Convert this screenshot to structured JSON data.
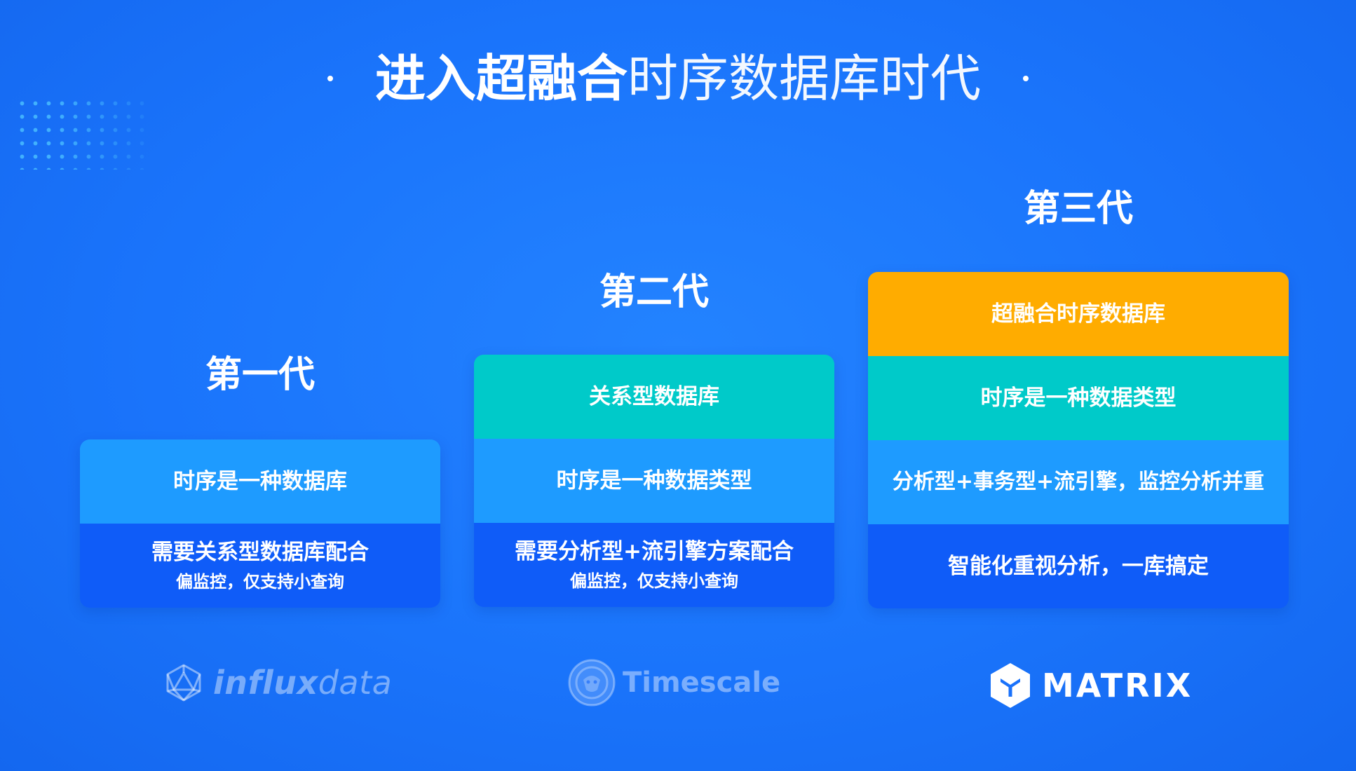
{
  "title": {
    "bold": "进入超融合",
    "light": "时序数据库时代"
  },
  "generations": [
    {
      "label": "第一代",
      "rows": [
        {
          "text": "时序是一种数据库",
          "color": "#1e9bff"
        },
        {
          "text": "需要关系型数据库配合",
          "sub": "偏监控，仅支持小查询",
          "color": "#0f5cf8"
        }
      ],
      "logo": {
        "icon": "icosahedron-icon",
        "bold": "influx",
        "light": "data"
      }
    },
    {
      "label": "第二代",
      "rows": [
        {
          "text": "关系型数据库",
          "color": "#00cac9"
        },
        {
          "text": "时序是一种数据类型",
          "color": "#1e9bff"
        },
        {
          "text": "需要分析型+流引擎方案配合",
          "sub": "偏监控，仅支持小查询",
          "color": "#0f5cf8"
        }
      ],
      "logo": {
        "icon": "tiger-emblem-icon",
        "text": "Timescale"
      }
    },
    {
      "label": "第三代",
      "rows": [
        {
          "text": "超融合时序数据库",
          "color": "#ffac00"
        },
        {
          "text": "时序是一种数据类型",
          "color": "#00cac9"
        },
        {
          "text": "分析型+事务型+流引擎，监控分析并重",
          "color": "#1e9bff"
        },
        {
          "text": "智能化重视分析，一库搞定",
          "color": "#0f5cf8"
        }
      ],
      "logo": {
        "icon": "hexagon-y-icon",
        "text": "MATRIX"
      }
    }
  ]
}
